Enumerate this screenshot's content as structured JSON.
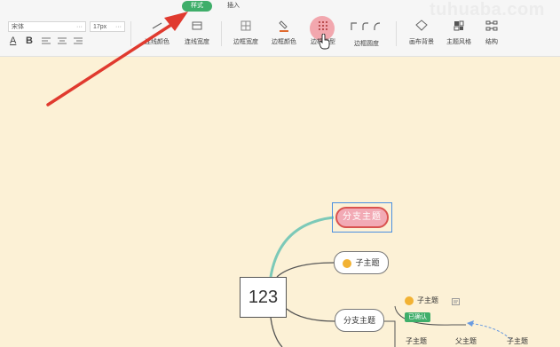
{
  "watermark": "tuhuaba.com",
  "tabs": [
    {
      "label": "样式",
      "active": true
    },
    {
      "label": "插入",
      "active": false
    }
  ],
  "font": {
    "family": "宋体",
    "size": "17px",
    "more": "···"
  },
  "format_buttons": [
    "A",
    "B"
  ],
  "tools": [
    {
      "label": "连线颜色",
      "icon": "line-color-icon"
    },
    {
      "label": "连线宽度",
      "icon": "line-width-icon"
    },
    {
      "label": "边框宽度",
      "icon": "border-width-icon"
    },
    {
      "label": "边框颜色",
      "icon": "border-color-icon"
    },
    {
      "label": "边框类型",
      "icon": "border-type-icon"
    },
    {
      "label": "边框圆度",
      "icon": "border-radius-icon"
    },
    {
      "label": "画布背景",
      "icon": "canvas-background-icon"
    },
    {
      "label": "主题风格",
      "icon": "theme-style-icon"
    },
    {
      "label": "结构",
      "icon": "structure-icon"
    }
  ],
  "mindmap": {
    "root": "123",
    "selected_branch": "分支主题",
    "child_topic": "子主题",
    "branch2": "分支主题",
    "sub_topic": "子主题",
    "badge": "已确认",
    "bottom_labels": [
      "子主题",
      "父主题",
      "子主题"
    ]
  },
  "colors": {
    "accent": "#3fae6a",
    "canvas": "#fcf1d6",
    "selection": "#4a8fe0",
    "arrow": "#e03a2f",
    "line_teal": "#7cc9b8"
  }
}
